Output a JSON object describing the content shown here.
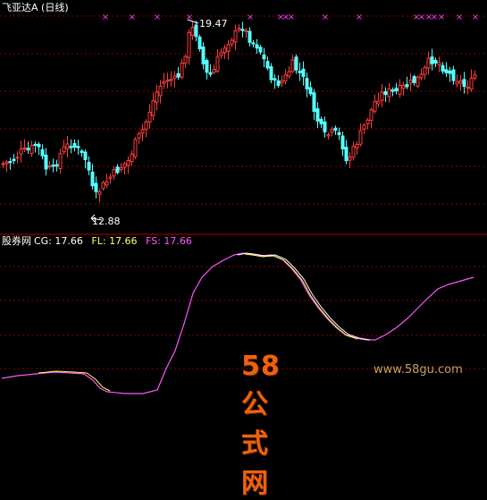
{
  "header": {
    "title": "飞亚达A (日线)"
  },
  "main_panel": {
    "high_label": "19.47",
    "low_label": "12.88",
    "colors": {
      "up": "#ff3c3c",
      "down": "#54ffff",
      "marker": "#ff3cff",
      "grid": "#8b0000"
    }
  },
  "indicator_panel": {
    "name": "股券网",
    "cg": {
      "label": "CG: 17.66",
      "color": "#ffffff"
    },
    "fl": {
      "label": "FL: 17.66",
      "color": "#ffff54"
    },
    "fs": {
      "label": "FS: 17.66",
      "color": "#ff54ff"
    }
  },
  "watermark": {
    "brand": "58公式网",
    "url": "www.58gu.com"
  },
  "chart_data": [
    {
      "type": "candlestick",
      "title": "飞亚达A (日线)",
      "annotations": [
        "19.47",
        "12.88"
      ],
      "price_high": 19.47,
      "price_low": 12.88
    },
    {
      "type": "line",
      "series": [
        {
          "name": "CG",
          "last": 17.66,
          "color": "#ffffff"
        },
        {
          "name": "FL",
          "last": 17.66,
          "color": "#ffff54"
        },
        {
          "name": "FS",
          "last": 17.66,
          "color": "#ff54ff"
        }
      ]
    }
  ]
}
